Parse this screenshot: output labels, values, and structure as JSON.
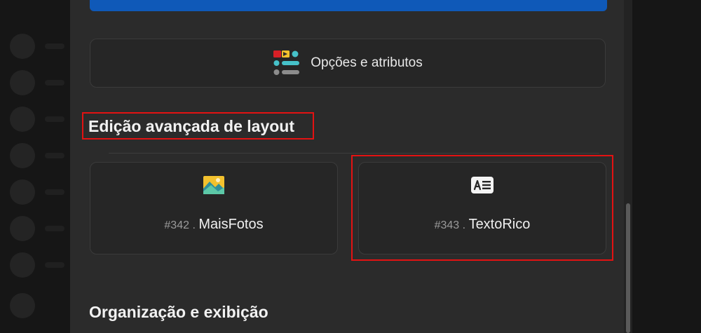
{
  "options": {
    "label": "Opções e atributos",
    "icon": "options-attributes-icon"
  },
  "sections": [
    {
      "title": "Edição avançada de layout"
    },
    {
      "title": "Organização e exibição"
    }
  ],
  "plugins": [
    {
      "number": "#342",
      "separator": ".",
      "name": "MaisFotos",
      "icon": "photos-icon"
    },
    {
      "number": "#343",
      "separator": ".",
      "name": "TextoRico",
      "icon": "rich-text-icon"
    }
  ],
  "colors": {
    "panel_bg": "#2b2b2b",
    "card_bg": "#262626",
    "accent_blue": "#0f59b8",
    "highlight_red": "#e31212"
  }
}
